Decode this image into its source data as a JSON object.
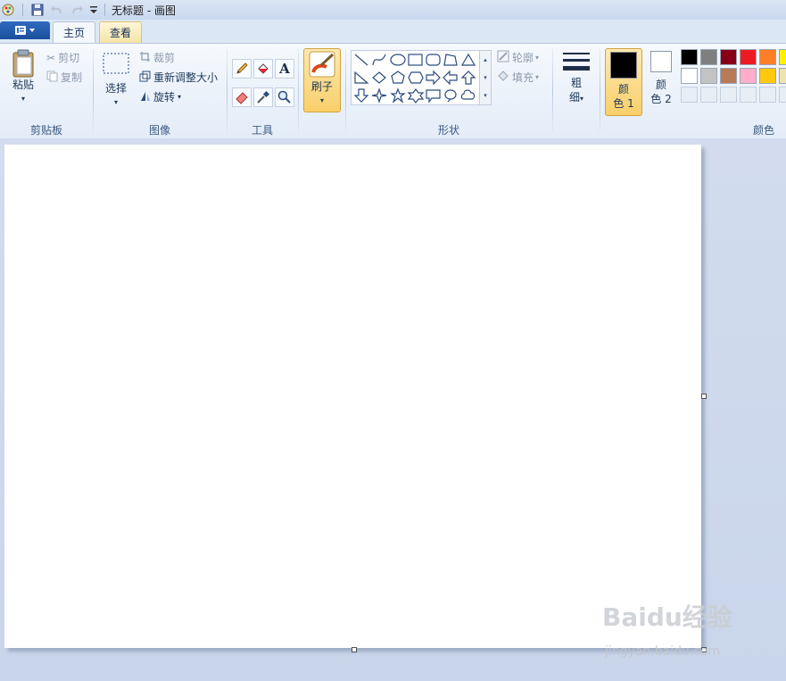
{
  "window": {
    "title": "无标题 - 画图"
  },
  "tabs": {
    "home": "主页",
    "view": "查看"
  },
  "clipboard": {
    "paste": "粘贴",
    "cut": "剪切",
    "copy": "复制",
    "label": "剪贴板"
  },
  "image": {
    "select": "选择",
    "crop": "裁剪",
    "resize": "重新调整大小",
    "rotate": "旋转",
    "label": "图像"
  },
  "tools": {
    "label": "工具",
    "items": [
      "pencil-icon",
      "fill-icon",
      "text-icon",
      "eraser-icon",
      "color-picker-icon",
      "magnifier-icon"
    ]
  },
  "brushes": {
    "label": "刷子"
  },
  "shapes": {
    "label": "形状",
    "outline": "轮廓",
    "fill": "填充"
  },
  "size": {
    "label_line1": "粗",
    "label_line2": "细"
  },
  "colors": {
    "label": "颜色",
    "color1_line1": "颜",
    "color1_line2": "色 1",
    "color2_line1": "颜",
    "color2_line2": "色 2",
    "color1": "#000000",
    "color2": "#ffffff",
    "palette_row1": [
      "#000000",
      "#7f7f7f",
      "#880015",
      "#ed1c24",
      "#ff7f27",
      "#fff200"
    ],
    "palette_row2": [
      "#ffffff",
      "#c3c3c3",
      "#b97a57",
      "#ffaec9",
      "#ffc90e",
      "#efe4b0"
    ]
  },
  "watermark": {
    "brand": "Baidu经验",
    "url": "jingyan.baidu.com"
  }
}
